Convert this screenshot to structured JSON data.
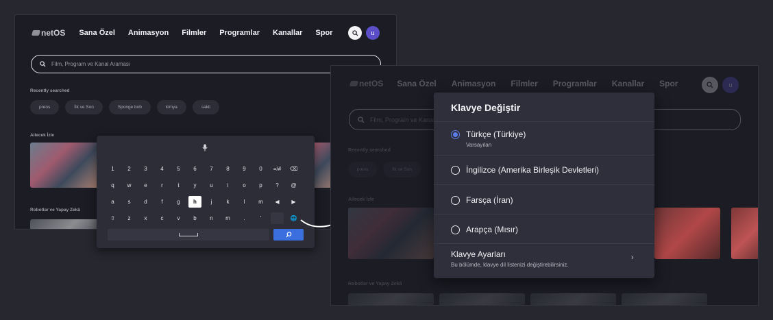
{
  "header": {
    "logo_text": "netOS",
    "nav": [
      "Sana Özel",
      "Animasyon",
      "Filmler",
      "Programlar",
      "Kanallar",
      "Spor"
    ],
    "avatar_letter": "u"
  },
  "search": {
    "placeholder": "Film, Program ve Kanal Araması"
  },
  "recent": {
    "title": "Recently searched",
    "chips": [
      "prens",
      "İlk ve Son",
      "Sponge bob",
      "kimya",
      "sakli"
    ]
  },
  "sections": {
    "watch_title": "Ailecek İzle",
    "robots_title": "Robotlar ve Yapay Zekâ"
  },
  "keyboard": {
    "rows": [
      [
        "1",
        "2",
        "3",
        "4",
        "5",
        "6",
        "7",
        "8",
        "9",
        "0",
        "=/#",
        "⌫"
      ],
      [
        "q",
        "w",
        "e",
        "r",
        "t",
        "y",
        "u",
        "i",
        "o",
        "p",
        "?",
        "@"
      ],
      [
        "a",
        "s",
        "d",
        "f",
        "g",
        "h",
        "j",
        "k",
        "l",
        "m",
        "◀",
        "▶"
      ],
      [
        "⇧",
        "z",
        "x",
        "c",
        "v",
        "b",
        "n",
        "m",
        ".",
        "'",
        "",
        "🌐"
      ]
    ],
    "active_key": "h"
  },
  "dialog": {
    "title": "Klavye Değiştir",
    "options": [
      {
        "label": "Türkçe (Türkiye)",
        "sub": "Varsayılan",
        "checked": true
      },
      {
        "label": "İngilizce (Amerika Birleşik Devletleri)",
        "sub": "",
        "checked": false
      },
      {
        "label": "Farsça (İran)",
        "sub": "",
        "checked": false
      },
      {
        "label": "Arapça (Mısır)",
        "sub": "",
        "checked": false
      }
    ],
    "settings_title": "Klavye Ayarları",
    "settings_sub": "Bu bölümde, klavye dil listenizi değiştirebilirsiniz."
  },
  "colors": {
    "accent": "#3b6fe0",
    "radio_checked": "#5b7de8",
    "avatar": "#5a4fc8"
  }
}
